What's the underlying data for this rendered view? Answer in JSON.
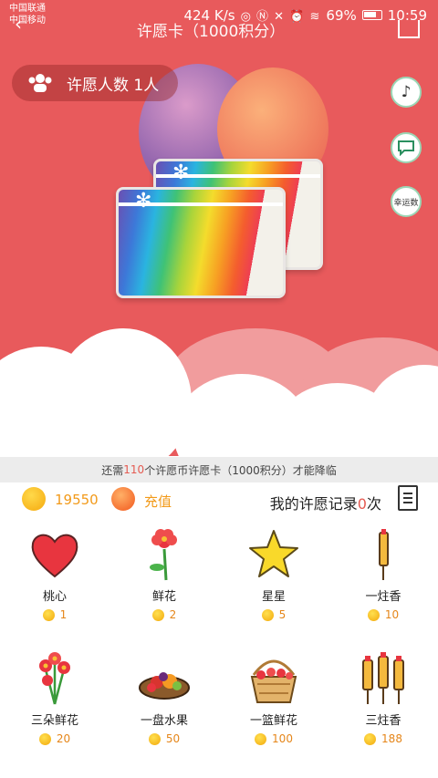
{
  "status": {
    "carrier1": "中国联通",
    "carrier2": "中国移动",
    "speed": "424 K/s",
    "battery": "69%",
    "time": "10:59"
  },
  "header": {
    "title_fragment": "许愿卡（1000积分）"
  },
  "wish_count_label": "许愿人数 1人",
  "side_buttons": {
    "music_icon": "music-note-icon",
    "chat_icon": "chat-bubble-icon",
    "lucky_label": "幸运数"
  },
  "banner": {
    "prefix": "还需",
    "count": "110",
    "suffix": "个许愿币许愿卡（1000积分）才能降临"
  },
  "wallet": {
    "balance": "19550",
    "recharge_label": "充值",
    "record_prefix": "我的许愿记录",
    "record_count": "0",
    "record_suffix": "次"
  },
  "gifts": [
    {
      "name": "桃心",
      "price": "1",
      "icon": "heart-icon"
    },
    {
      "name": "鲜花",
      "price": "2",
      "icon": "flower-icon"
    },
    {
      "name": "星星",
      "price": "5",
      "icon": "star-icon"
    },
    {
      "name": "一炷香",
      "price": "10",
      "icon": "incense-icon"
    },
    {
      "name": "三朵鲜花",
      "price": "20",
      "icon": "three-flowers-icon"
    },
    {
      "name": "一盘水果",
      "price": "50",
      "icon": "fruit-plate-icon"
    },
    {
      "name": "一篮鲜花",
      "price": "100",
      "icon": "flower-basket-icon"
    },
    {
      "name": "三炷香",
      "price": "188",
      "icon": "three-incense-icon"
    }
  ],
  "colors": {
    "hero_bg": "#e85a5c",
    "accent": "#e55b52",
    "coin": "#f29a1a"
  }
}
